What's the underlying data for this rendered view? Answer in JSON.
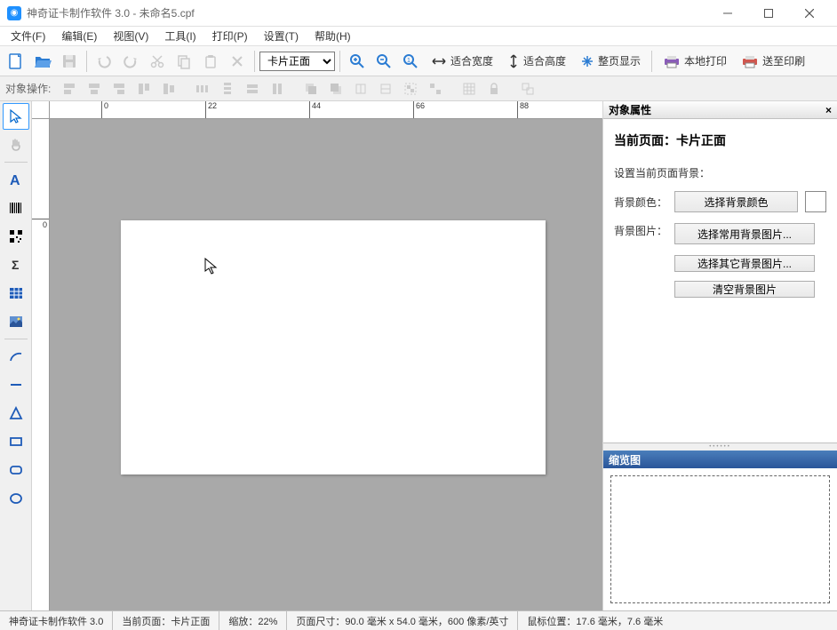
{
  "window": {
    "title": "神奇证卡制作软件 3.0 - 未命名5.cpf"
  },
  "menu": {
    "file": "文件(F)",
    "edit": "编辑(E)",
    "view": "视图(V)",
    "tools": "工具(I)",
    "print": "打印(P)",
    "settings": "设置(T)",
    "help": "帮助(H)"
  },
  "toolbar": {
    "card_side_label": "卡片正面",
    "fit_width": "适合宽度",
    "fit_height": "适合高度",
    "fit_page": "整页显示",
    "local_print": "本地打印",
    "send_print": "送至印刷"
  },
  "obj_toolbar": {
    "label": "对象操作:"
  },
  "ruler": {
    "h_ticks": [
      "0",
      "22",
      "44",
      "66",
      "88"
    ],
    "v_ticks": [
      "0"
    ]
  },
  "properties": {
    "panel_title": "对象属性",
    "page_title": "当前页面：卡片正面",
    "bg_section": "设置当前页面背景：",
    "bg_color_label": "背景颜色：",
    "bg_color_btn": "选择背景颜色",
    "bg_image_label": "背景图片：",
    "bg_common_btn": "选择常用背景图片...",
    "bg_other_btn": "选择其它背景图片...",
    "bg_clear_btn": "清空背景图片"
  },
  "thumbnail": {
    "title": "缩览图"
  },
  "status": {
    "app": "神奇证卡制作软件 3.0",
    "page": "当前页面：卡片正面",
    "zoom": "缩放：22%",
    "size": "页面尺寸：90.0 毫米 x 54.0 毫米，600 像素/英寸",
    "mouse": "鼠标位置：17.6 毫米，7.6 毫米"
  }
}
